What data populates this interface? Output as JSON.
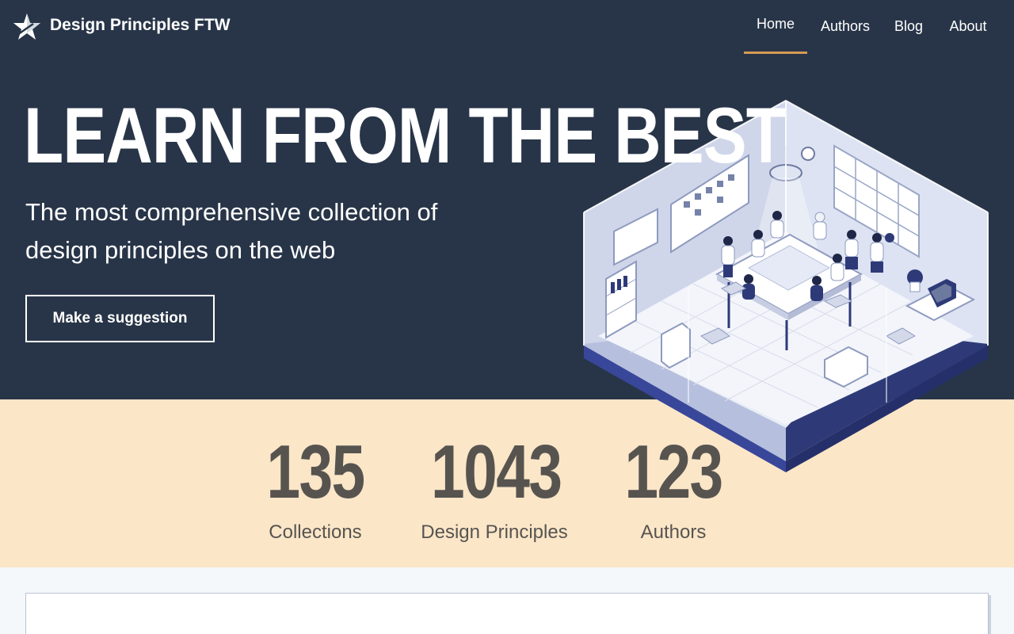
{
  "header": {
    "site_title": "Design Principles FTW",
    "logo_icon": "star-icon",
    "nav": [
      {
        "label": "Home",
        "active": true
      },
      {
        "label": "Authors",
        "active": false
      },
      {
        "label": "Blog",
        "active": false
      },
      {
        "label": "About",
        "active": false
      }
    ]
  },
  "hero": {
    "headline": "LEARN FROM THE BEST",
    "subtitle_line1": "The most comprehensive collection of",
    "subtitle_line2": "design principles on the web",
    "cta_label": "Make a suggestion",
    "illustration": "isometric-office-illustration"
  },
  "stats": [
    {
      "value": "135",
      "label": "Collections"
    },
    {
      "value": "1043",
      "label": "Design Principles"
    },
    {
      "value": "123",
      "label": "Authors"
    }
  ],
  "colors": {
    "hero_bg": "#283548",
    "accent": "#d69a53",
    "stats_bg": "#fbe6c8",
    "stats_text": "#575450"
  }
}
